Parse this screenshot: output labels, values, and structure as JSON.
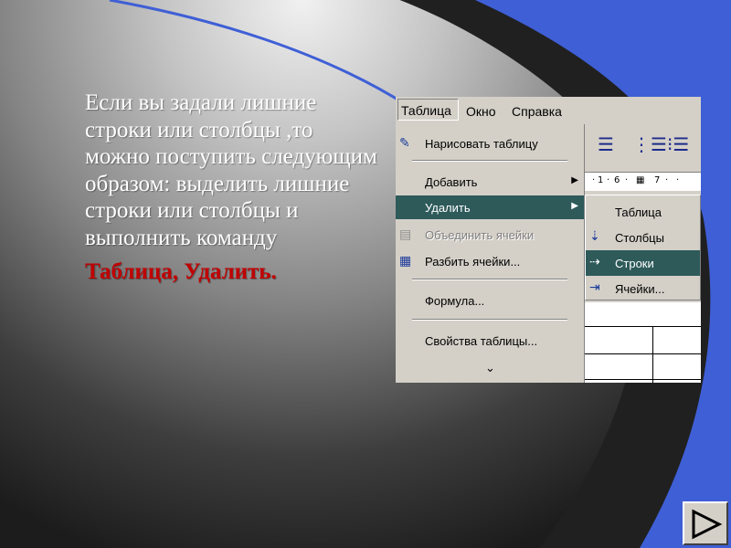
{
  "slide": {
    "body_text": "Если вы задали лишние строки или столбцы ,то можно поступить следующим образом: выделить лишние строки или столбцы и выполнить команду",
    "command_text": "Таблица, Удалить.",
    "accent_color": "#c00000",
    "arc_color": "#3f5fd6"
  },
  "menubar": {
    "items": [
      "Таблица",
      "Окно",
      "Справка"
    ]
  },
  "table_menu": {
    "items": [
      {
        "label": "Нарисовать таблицу",
        "icon": "pencil-icon"
      },
      {
        "label": "Добавить",
        "icon": "",
        "submenu": true
      },
      {
        "label": "Удалить",
        "icon": "",
        "submenu": true,
        "active": true
      },
      {
        "label": "Объединить ячейки",
        "icon": "merge-cells-icon",
        "disabled": true
      },
      {
        "label": "Разбить ячейки...",
        "icon": "split-cells-icon"
      },
      {
        "label": "Формула...",
        "icon": ""
      },
      {
        "label": "Свойства таблицы...",
        "icon": ""
      }
    ],
    "more_icon": "expand-chevron-icon"
  },
  "delete_submenu": {
    "items": [
      {
        "label": "Таблица",
        "icon": "delete-table-icon"
      },
      {
        "label": "Столбцы",
        "icon": "delete-columns-icon"
      },
      {
        "label": "Строки",
        "icon": "delete-rows-icon",
        "active": true
      },
      {
        "label": "Ячейки...",
        "icon": "delete-cells-icon"
      }
    ]
  },
  "toolbar": {
    "icons": [
      "justify-icon",
      "numbered-list-icon",
      "bullet-list-icon"
    ],
    "ruler_marks": [
      "1",
      "6",
      "7"
    ]
  },
  "nav": {
    "next_icon": "next-slide-icon"
  }
}
